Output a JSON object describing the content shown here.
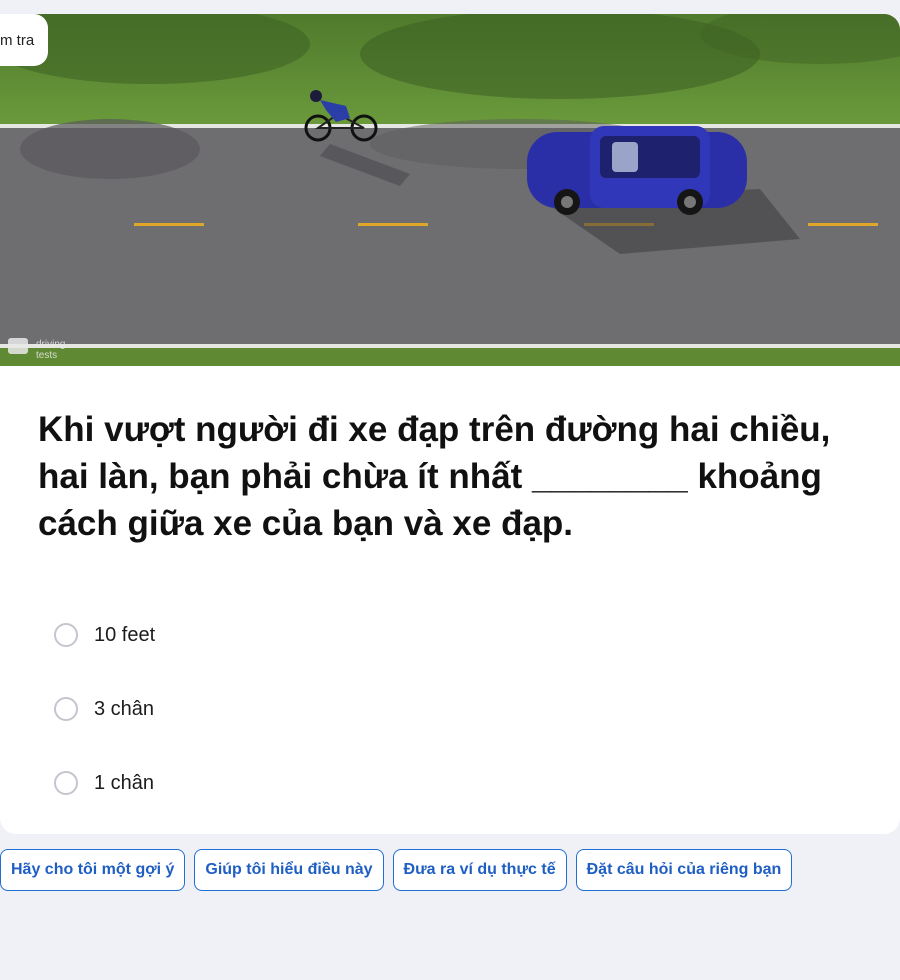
{
  "badge": {
    "label": "m tra"
  },
  "hero": {
    "watermark_top": "driving",
    "watermark_bottom": "tests",
    "logo_icon": "driving-tests-logo"
  },
  "question": {
    "text": "Khi vượt người đi xe đạp trên đường hai chiều, hai làn, bạn phải chừa ít nhất ________ khoảng cách giữa xe của bạn và xe đạp."
  },
  "options": [
    {
      "label": "10 feet",
      "selected": false
    },
    {
      "label": "3 chân",
      "selected": false
    },
    {
      "label": "1 chân",
      "selected": false
    }
  ],
  "chips": [
    {
      "label": "Hãy cho tôi một gợi ý"
    },
    {
      "label": "Giúp tôi hiểu điều này"
    },
    {
      "label": "Đưa ra ví dụ thực tế"
    },
    {
      "label": "Đặt câu hỏi của riêng bạn"
    }
  ],
  "colors": {
    "accent": "#1f6fd6",
    "background": "#eff1f6",
    "card": "#ffffff"
  }
}
